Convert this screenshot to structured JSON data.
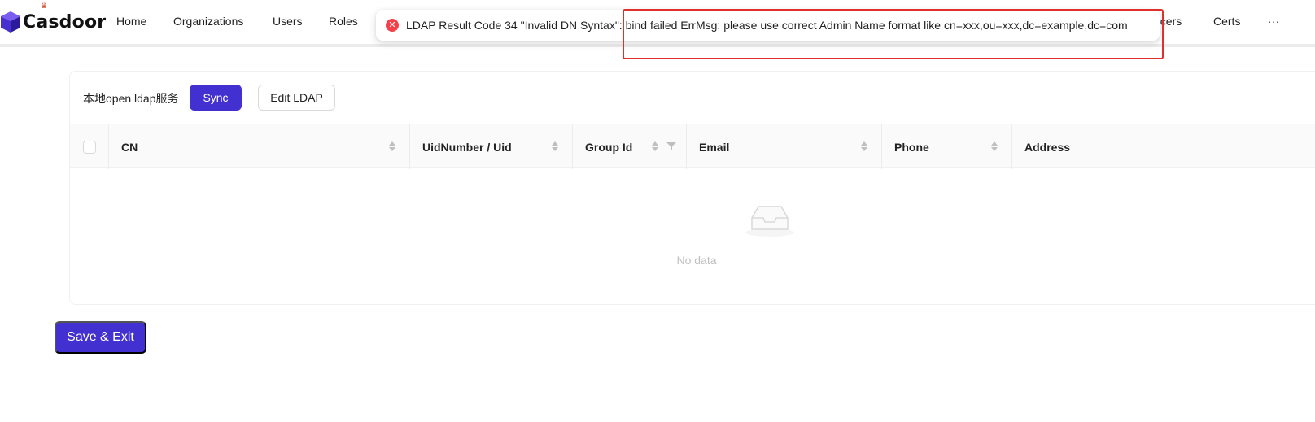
{
  "brand": {
    "name": "Casdoor"
  },
  "nav": {
    "items": [
      "Home",
      "Organizations",
      "Users",
      "Roles"
    ],
    "right_items": [
      "ncers",
      "Certs"
    ],
    "more": "···"
  },
  "toast": {
    "type": "error",
    "message": "LDAP Result Code 34 \"Invalid DN Syntax\": bind failed ErrMsg: please use correct Admin Name format like cn=xxx,ou=xxx,dc=example,dc=com"
  },
  "card": {
    "title": "本地open ldap服务",
    "sync_label": "Sync",
    "edit_label": "Edit LDAP"
  },
  "table": {
    "columns": [
      "CN",
      "UidNumber / Uid",
      "Group Id",
      "Email",
      "Phone",
      "Address"
    ],
    "rows": [],
    "empty_text": "No data"
  },
  "footer": {
    "save_label": "Save & Exit"
  },
  "colors": {
    "primary": "#4330d0",
    "error": "#f5404a",
    "highlight": "#e0302c"
  }
}
